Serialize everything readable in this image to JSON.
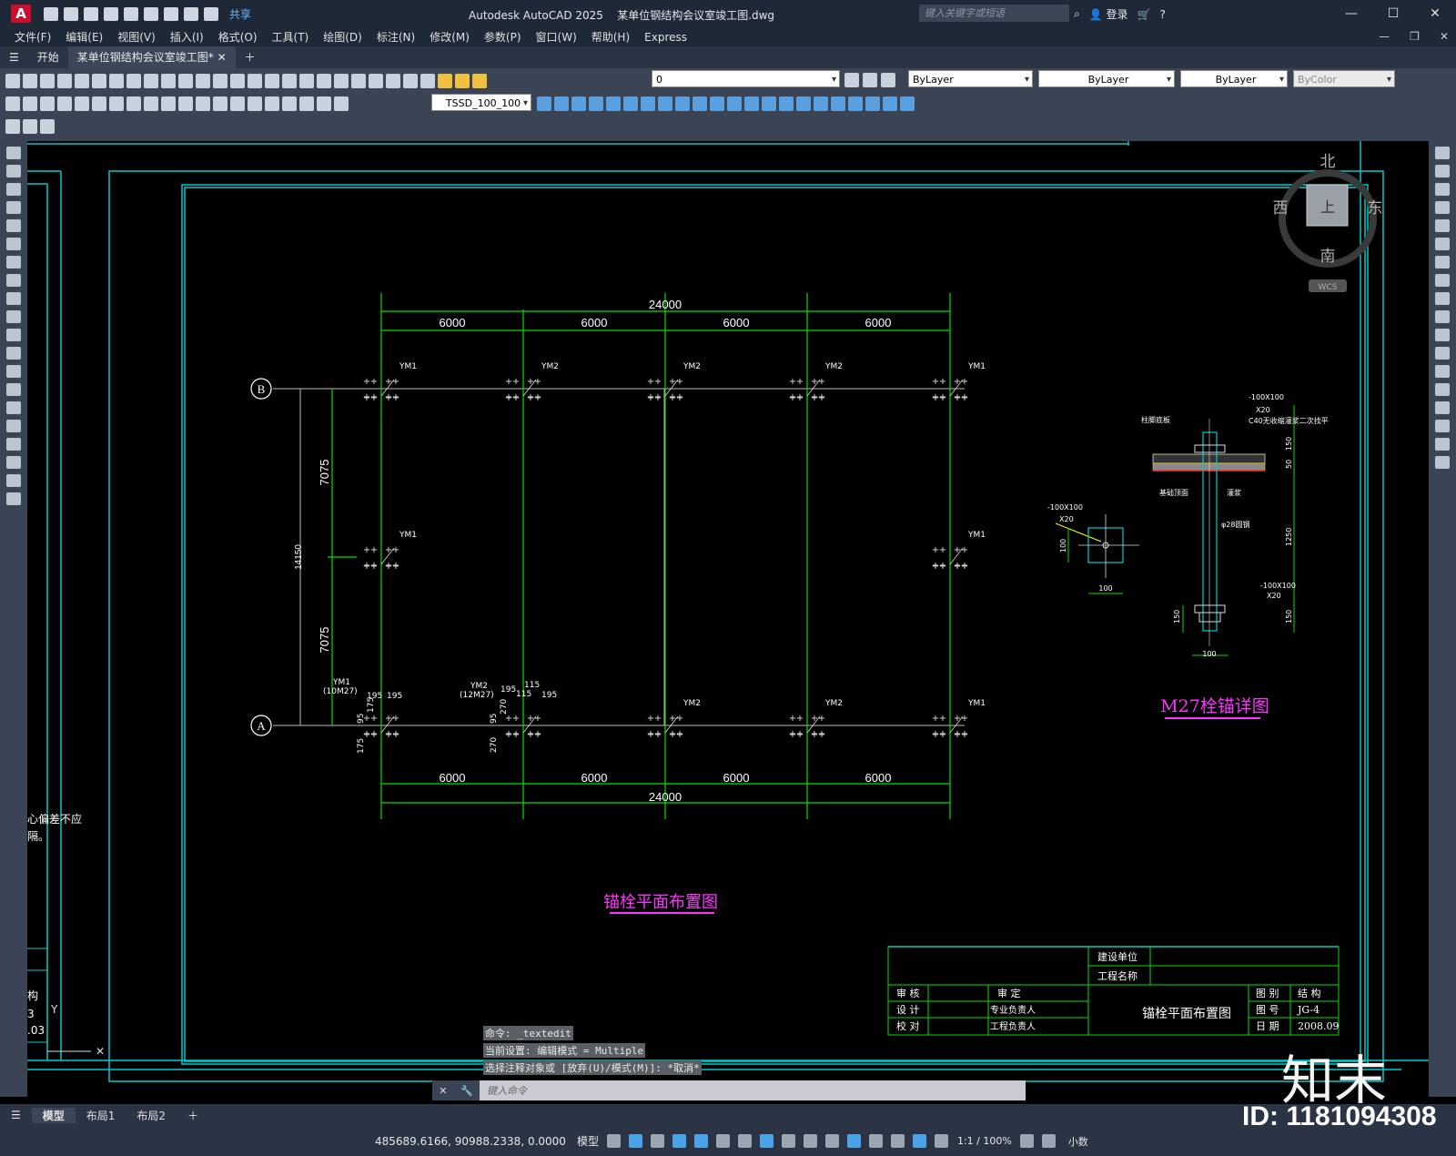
{
  "titlebar": {
    "logo": "A",
    "share": "共享",
    "app_title": "Autodesk AutoCAD 2025",
    "file_title": "某单位钢结构会议室竣工图.dwg",
    "search_placeholder": "键入关键字或短语",
    "login": "登录"
  },
  "menu": [
    "文件(F)",
    "编辑(E)",
    "视图(V)",
    "插入(I)",
    "格式(O)",
    "工具(T)",
    "绘图(D)",
    "标注(N)",
    "修改(M)",
    "参数(P)",
    "窗口(W)",
    "帮助(H)",
    "Express"
  ],
  "tabs": {
    "start": "开始",
    "doc": "某单位钢结构会议室竣工图*"
  },
  "ribbon": {
    "layer": "0",
    "color": "ByLayer",
    "linetype": "ByLayer",
    "lineweight": "ByLayer",
    "plotstyle": "ByColor",
    "textstyle": "TSSD_100_100"
  },
  "viewcube": {
    "north": "北",
    "south": "南",
    "west": "西",
    "east": "东",
    "top": "上",
    "wcs": "WCS"
  },
  "drawing": {
    "total_dim": "24000",
    "bay_dim": "6000",
    "half_dim": "7075",
    "total_y": "14150",
    "axis_a": "A",
    "axis_b": "B",
    "ym1": "YM1",
    "ym2": "YM2",
    "ym1_note": "(10M27)",
    "ym2_note": "(12M27)",
    "d195": "195",
    "d175": "175",
    "d95": "95",
    "d270": "270",
    "d115": "115",
    "plan_title": "锚栓平面布置图",
    "detail_title": "M27栓锚详图",
    "plate1": "-100X100",
    "x20": "X20",
    "c40": "C40无收缩灌浆二次找平",
    "col_base": "柱脚底板",
    "found_top": "基础顶面",
    "grout": "灌浆",
    "rod": "φ28圆钢",
    "d100": "100",
    "d150": "150",
    "d50": "50",
    "d1250": "1250",
    "side_note1": "心偏差不应",
    "side_note2": "隔。",
    "side_frag1": "构",
    "side_frag2": "3",
    "side_frag3": ".03"
  },
  "titleblock": {
    "client": "建设单位",
    "project": "工程名称",
    "check": "审 核",
    "approve": "审 定",
    "design": "设 计",
    "prof": "专业负责人",
    "proof": "校 对",
    "proj_mgr": "工程负责人",
    "drawing_name": "锚栓平面布置图",
    "cat_label": "图 别",
    "cat_value": "结 构",
    "no_label": "图 号",
    "no_value": "JG-4",
    "date_label": "日 期",
    "date_value": "2008.09"
  },
  "command": {
    "line1": "命令: _textedit",
    "line2": "当前设置: 编辑模式 = Multiple",
    "line3": "选择注释对象或 [放弃(U)/模式(M)]: *取消*",
    "placeholder": "键入命令"
  },
  "layout_tabs": [
    "模型",
    "布局1",
    "布局2"
  ],
  "status": {
    "coords": "485689.6166, 90988.2338, 0.0000",
    "model": "模型",
    "scale": "1:1 / 100%",
    "units": "小数"
  },
  "watermark": {
    "id": "ID: 1181094308",
    "logo": "知末"
  }
}
